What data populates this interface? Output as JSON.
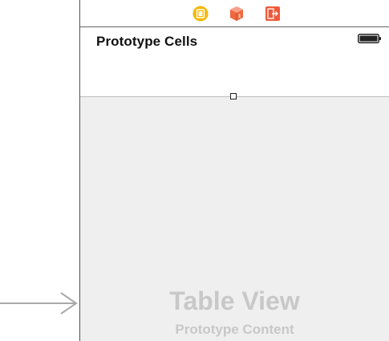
{
  "scene": {
    "nav_title": "Prototype Cells",
    "table_view": {
      "title": "Table View",
      "subtitle": "Prototype Content"
    },
    "dock": {
      "icons": [
        "view-controller-icon",
        "first-responder-icon",
        "exit-icon"
      ]
    }
  },
  "colors": {
    "view_controller": "#f5b800",
    "first_responder": "#f0673f",
    "exit": "#ef5a3a",
    "placeholder_text": "#c8c8c8",
    "table_background": "#efefef"
  }
}
